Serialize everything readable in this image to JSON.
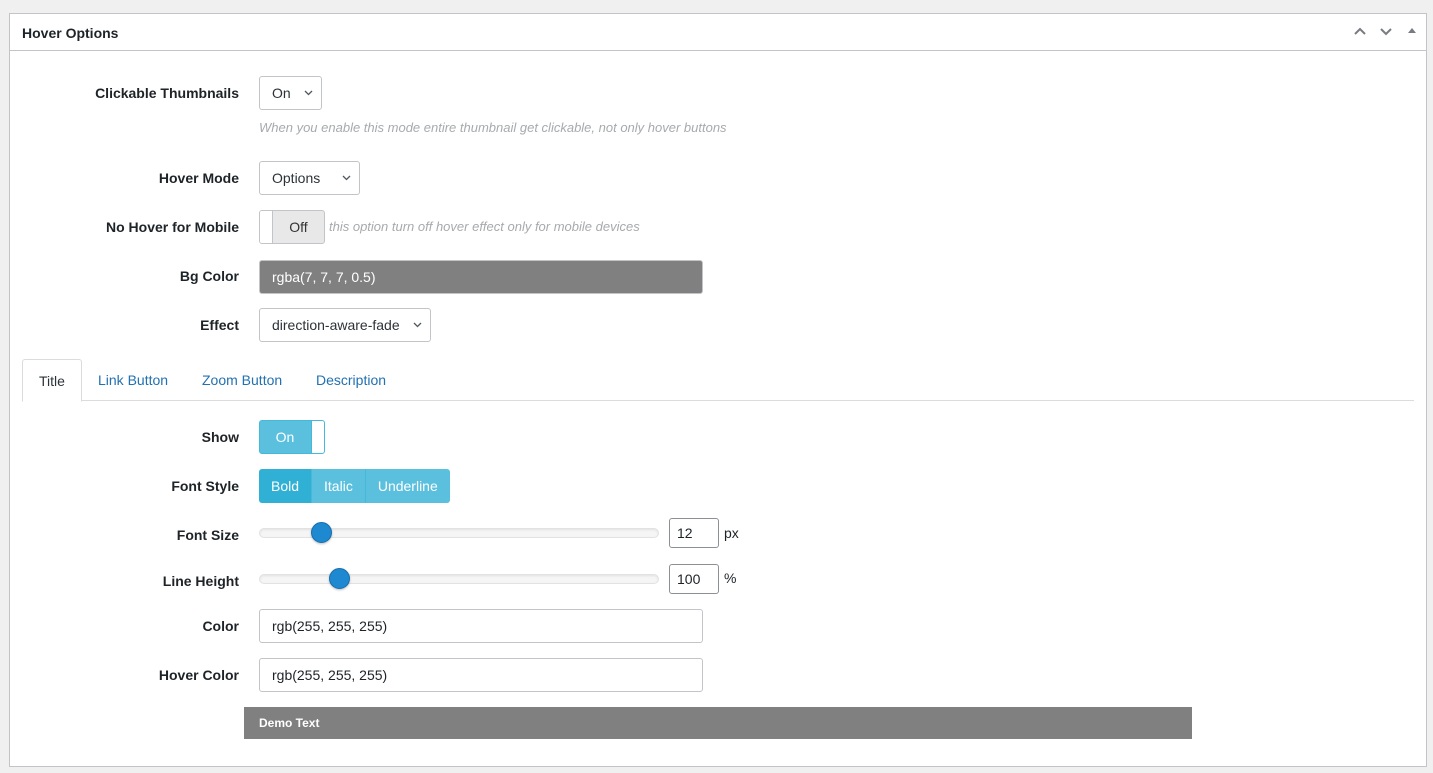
{
  "panel": {
    "title": "Hover Options",
    "header_icons": [
      "chevron-up-icon",
      "chevron-down-icon",
      "triangle-up-icon"
    ]
  },
  "clickable_thumbnails": {
    "label": "Clickable Thumbnails",
    "value": "On",
    "help": "When you enable this mode entire thumbnail get clickable, not only hover buttons"
  },
  "hover_mode": {
    "label": "Hover Mode",
    "value": "Options"
  },
  "no_hover_mobile": {
    "label": "No Hover for Mobile",
    "value": "Off",
    "help": "this option turn off hover effect only for mobile devices"
  },
  "bg_color": {
    "label": "Bg Color",
    "value": "rgba(7, 7, 7, 0.5)",
    "swatch": "#808080"
  },
  "effect": {
    "label": "Effect",
    "value": "direction-aware-fade"
  },
  "tabs": [
    {
      "label": "Title",
      "active": true
    },
    {
      "label": "Link Button",
      "active": false
    },
    {
      "label": "Zoom Button",
      "active": false
    },
    {
      "label": "Description",
      "active": false
    }
  ],
  "show": {
    "label": "Show",
    "value": "On"
  },
  "font_style": {
    "label": "Font Style",
    "options": [
      "Bold",
      "Italic",
      "Underline"
    ],
    "selected": "Bold"
  },
  "font_size": {
    "label": "Font Size",
    "value": "12",
    "unit": "px"
  },
  "line_height": {
    "label": "Line Height",
    "value": "100",
    "unit": "%"
  },
  "color": {
    "label": "Color",
    "value": "rgb(255, 255, 255)"
  },
  "hover_color": {
    "label": "Hover Color",
    "value": "rgb(255, 255, 255)"
  },
  "demo": {
    "text": "Demo Text"
  },
  "colors": {
    "accent": "#5bc0de",
    "accent_active": "#31b0d5",
    "slider_knob": "#1e88d0",
    "link": "#2271b1"
  }
}
